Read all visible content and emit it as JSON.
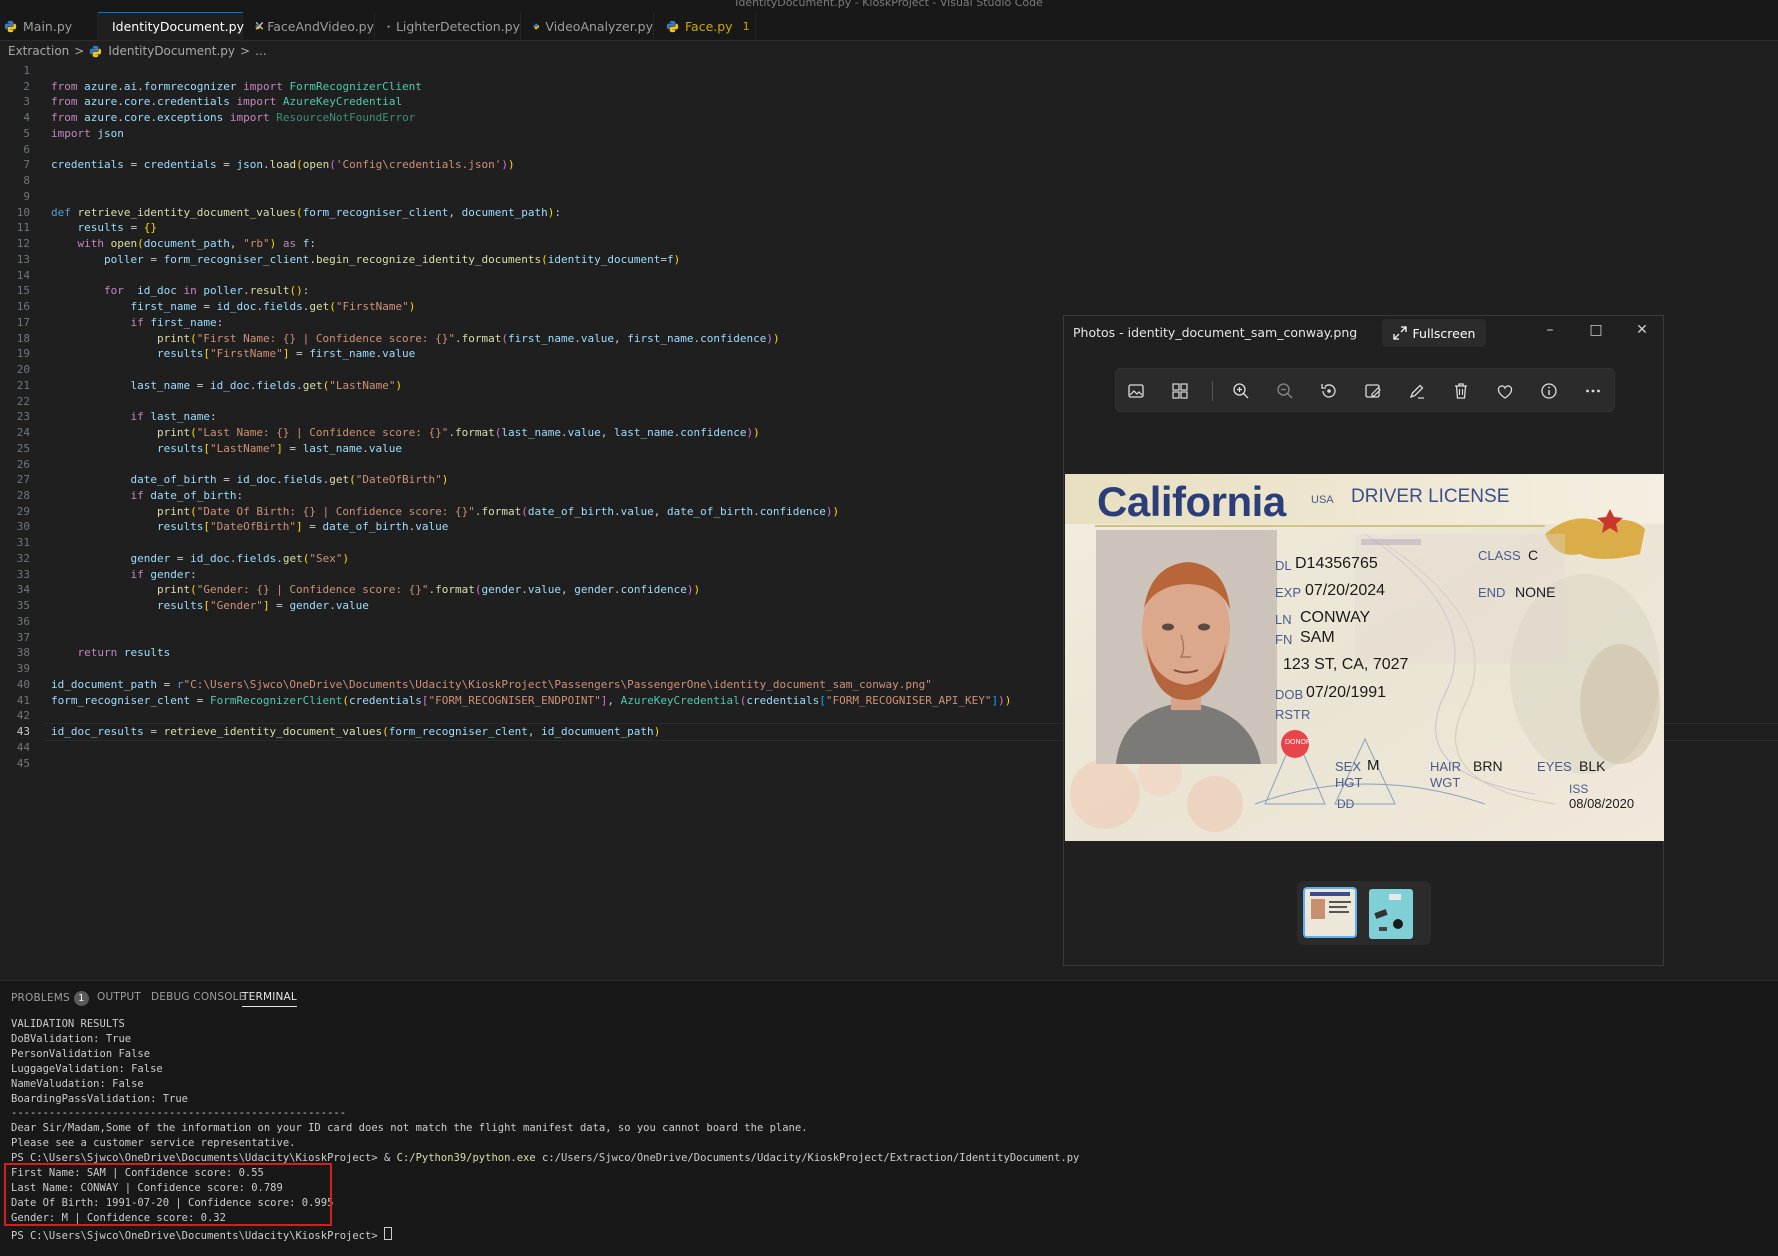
{
  "window": {
    "title": "IdentityDocument.py - KioskProject - Visual Studio Code"
  },
  "tabs": [
    {
      "label": "Main.py"
    },
    {
      "label": "IdentityDocument.py",
      "close": "×"
    },
    {
      "label": "FaceAndVideo.py"
    },
    {
      "label": "LighterDetection.py"
    },
    {
      "label": "VideoAnalyzer.py"
    },
    {
      "label": "Face.py",
      "badge": "1"
    }
  ],
  "breadcrumb": {
    "folder": "Extraction",
    "sep1": ">",
    "file": "IdentityDocument.py",
    "sep2": ">",
    "more": "..."
  },
  "editor": {
    "line_numbers": [
      "1",
      "2",
      "3",
      "4",
      "5",
      "6",
      "7",
      "8",
      "9",
      "10",
      "11",
      "12",
      "13",
      "14",
      "15",
      "16",
      "17",
      "18",
      "19",
      "20",
      "21",
      "22",
      "23",
      "24",
      "25",
      "26",
      "27",
      "28",
      "29",
      "30",
      "31",
      "32",
      "33",
      "34",
      "35",
      "36",
      "37",
      "38",
      "39",
      "40",
      "41",
      "42",
      "43",
      "44",
      "45"
    ],
    "current_line": "43",
    "lines": [
      "",
      "from azure.ai.formrecognizer import FormRecognizerClient",
      "from azure.core.credentials import AzureKeyCredential",
      "from azure.core.exceptions import ResourceNotFoundError",
      "import json",
      "",
      "credentials = credentials = json.load(open('Config\\credentials.json'))",
      "",
      "",
      "def retrieve_identity_document_values(form_recogniser_client, document_path):",
      "    results = {}",
      "    with open(document_path, \"rb\") as f:",
      "        poller = form_recogniser_client.begin_recognize_identity_documents(identity_document=f)",
      "",
      "        for  id_doc in poller.result():",
      "            first_name = id_doc.fields.get(\"FirstName\")",
      "            if first_name:",
      "                print(\"First Name: {} | Confidence score: {}\".format(first_name.value, first_name.confidence))",
      "                results[\"FirstName\"] = first_name.value",
      "",
      "            last_name = id_doc.fields.get(\"LastName\")",
      "",
      "            if last_name:",
      "                print(\"Last Name: {} | Confidence score: {}\".format(last_name.value, last_name.confidence))",
      "                results[\"LastName\"] = last_name.value",
      "",
      "            date_of_birth = id_doc.fields.get(\"DateOfBirth\")",
      "            if date_of_birth:",
      "                print(\"Date Of Birth: {} | Confidence score: {}\".format(date_of_birth.value, date_of_birth.confidence))",
      "                results[\"DateOfBirth\"] = date_of_birth.value",
      "",
      "            gender = id_doc.fields.get(\"Sex\")",
      "            if gender:",
      "                print(\"Gender: {} | Confidence score: {}\".format(gender.value, gender.confidence))",
      "                results[\"Gender\"] = gender.value",
      "",
      "",
      "    return results",
      "",
      "id_document_path = r\"C:\\Users\\Sjwco\\OneDrive\\Documents\\Udacity\\KioskProject\\Passengers\\PassengerOne\\identity_document_sam_conway.png\"",
      "form_recogniser_clent = FormRecognizerClient(credentials[\"FORM_RECOGNISER_ENDPOINT\"], AzureKeyCredential(credentials[\"FORM_RECOGNISER_API_KEY\"]))",
      "",
      "id_doc_results = retrieve_identity_document_values(form_recogniser_clent, id_documuent_path)",
      "",
      ""
    ]
  },
  "photos": {
    "title": "Photos - identity_document_sam_conway.png",
    "fullscreen_label": "Fullscreen",
    "controls": {
      "minimize": "–",
      "maximize": "□",
      "close": "✕"
    },
    "toolbar_icons": [
      "image-icon",
      "collection-icon",
      "zoom-in-icon",
      "zoom-out-icon",
      "rotate-icon",
      "edit-image-icon",
      "markup-icon",
      "delete-icon",
      "favorite-icon",
      "info-icon",
      "more-icon"
    ],
    "license": {
      "state": "California",
      "country": "USA",
      "doc_type": "DRIVER LICENSE",
      "dl_label": "DL",
      "dl_value": "D14356765",
      "exp_label": "EXP",
      "exp_value": "07/20/2024",
      "ln_label": "LN",
      "ln_value": "CONWAY",
      "fn_label": "FN",
      "fn_value": "SAM",
      "address": "123 ST, CA, 7027",
      "dob_label": "DOB",
      "dob_value": "07/20/1991",
      "rstr_label": "RSTR",
      "donor_label": "DONOR",
      "class_label": "CLASS",
      "class_value": "C",
      "end_label": "END",
      "end_value": "NONE",
      "sex_label": "SEX",
      "sex_value": "M",
      "hgt_label": "HGT",
      "hair_label": "HAIR",
      "hair_value": "BRN",
      "wgt_label": "WGT",
      "eyes_label": "EYES",
      "eyes_value": "BLK",
      "iss_label": "ISS",
      "iss_value": "08/08/2020",
      "dd_label": "DD"
    }
  },
  "panel": {
    "tabs": [
      {
        "label": "PROBLEMS",
        "badge": "1"
      },
      {
        "label": "OUTPUT"
      },
      {
        "label": "DEBUG CONSOLE"
      },
      {
        "label": "TERMINAL"
      }
    ],
    "terminal_lines": [
      "VALIDATION RESULTS",
      "DoBValidation: True",
      "PersonValidation False",
      "LuggageValidation: False",
      "NameValudation: False",
      "BoardingPassValidation: True",
      "-----------------------------------------------------",
      "Dear Sir/Madam,Some of the information on your ID card does not match the flight manifest data, so you cannot board the plane.",
      "Please see a customer service representative.",
      "",
      "First Name: SAM | Confidence score: 0.55",
      "Last Name: CONWAY | Confidence score: 0.789",
      "Date Of Birth: 1991-07-20 | Confidence score: 0.995",
      "Gender: M | Confidence score: 0.32",
      ""
    ],
    "prompt_line": {
      "prompt": "PS C:\\Users\\Sjwco\\OneDrive\\Documents\\Udacity\\KioskProject> & ",
      "exe": "C:/Python39/python.exe",
      "script": " c:/Users/Sjwco/OneDrive/Documents/Udacity/KioskProject/Extraction/IdentityDocument.py"
    },
    "final_prompt": "PS C:\\Users\\Sjwco\\OneDrive\\Documents\\Udacity\\KioskProject> "
  }
}
